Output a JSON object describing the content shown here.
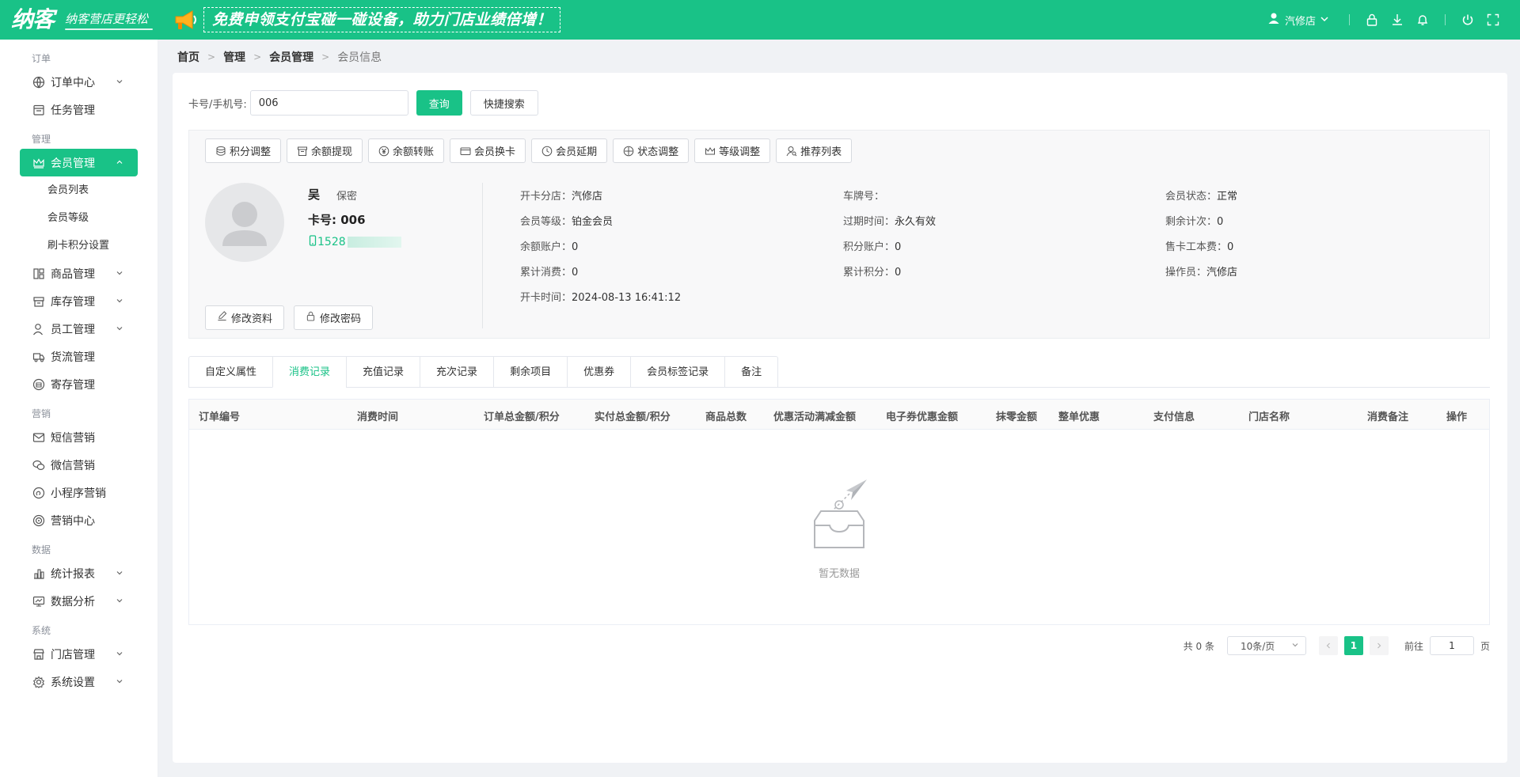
{
  "header": {
    "logo_text": "纳客",
    "slogan": "纳客营店更轻松",
    "promo_text": "免费申领支付宝碰一碰设备，助力门店业绩倍增！",
    "store_name": "汽修店",
    "colors": {
      "brand": "#19c287"
    }
  },
  "sidebar": {
    "groups": [
      {
        "label": "订单",
        "items": [
          {
            "label": "订单中心",
            "icon": "globe-icon"
          },
          {
            "label": "任务管理",
            "icon": "calendar-icon"
          }
        ]
      },
      {
        "label": "管理",
        "items": [
          {
            "label": "会员管理",
            "icon": "crown-icon",
            "active": true,
            "subitems": [
              "会员列表",
              "会员等级",
              "刷卡积分设置"
            ]
          },
          {
            "label": "商品管理",
            "icon": "grid-icon"
          },
          {
            "label": "库存管理",
            "icon": "box-icon"
          },
          {
            "label": "员工管理",
            "icon": "person-icon"
          },
          {
            "label": "货流管理",
            "icon": "truck-icon"
          },
          {
            "label": "寄存管理",
            "icon": "deposit-icon"
          }
        ]
      },
      {
        "label": "营销",
        "items": [
          {
            "label": "短信营销",
            "icon": "mail-icon"
          },
          {
            "label": "微信营销",
            "icon": "wechat-icon"
          },
          {
            "label": "小程序营销",
            "icon": "miniapp-icon"
          },
          {
            "label": "营销中心",
            "icon": "target-icon"
          }
        ]
      },
      {
        "label": "数据",
        "items": [
          {
            "label": "统计报表",
            "icon": "bar-chart-icon"
          },
          {
            "label": "数据分析",
            "icon": "monitor-icon"
          }
        ]
      },
      {
        "label": "系统",
        "items": [
          {
            "label": "门店管理",
            "icon": "store-icon"
          },
          {
            "label": "系统设置",
            "icon": "gear-icon"
          }
        ]
      }
    ]
  },
  "breadcrumb": [
    "首页",
    "管理",
    "会员管理",
    "会员信息"
  ],
  "search": {
    "label": "卡号/手机号:",
    "value": "006",
    "query_button": "查询",
    "quick_button": "快捷搜索"
  },
  "actions": [
    "积分调整",
    "余额提现",
    "余额转账",
    "会员换卡",
    "会员延期",
    "状态调整",
    "等级调整",
    "推荐列表"
  ],
  "member": {
    "name": "吴",
    "gender": "保密",
    "card_label": "卡号: 006",
    "phone_prefix": "1528",
    "edit_profile": "修改资料",
    "edit_password": "修改密码",
    "fields": [
      {
        "label": "开卡分店：",
        "value": "汽修店"
      },
      {
        "label": "车牌号：",
        "value": ""
      },
      {
        "label": "会员状态：",
        "value": "正常"
      },
      {
        "label": "会员等级：",
        "value": "铂金会员"
      },
      {
        "label": "过期时间：",
        "value": "永久有效"
      },
      {
        "label": "剩余计次：",
        "value": "0"
      },
      {
        "label": "余额账户：",
        "value": "0"
      },
      {
        "label": "积分账户：",
        "value": "0"
      },
      {
        "label": "售卡工本费：",
        "value": "0"
      },
      {
        "label": "累计消费：",
        "value": "0"
      },
      {
        "label": "累计积分：",
        "value": "0"
      },
      {
        "label": "操作员：",
        "value": "汽修店"
      },
      {
        "label": "开卡时间：",
        "value": "2024-08-13 16:41:12"
      }
    ]
  },
  "tabs": [
    "自定义属性",
    "消费记录",
    "充值记录",
    "充次记录",
    "剩余项目",
    "优惠券",
    "会员标签记录",
    "备注"
  ],
  "active_tab": "消费记录",
  "table": {
    "columns": [
      "订单编号",
      "消费时间",
      "订单总金额/积分",
      "实付总金额/积分",
      "商品总数",
      "优惠活动满减金额",
      "电子券优惠金额",
      "抹零金额",
      "整单优惠",
      "支付信息",
      "门店名称",
      "消费备注",
      "操作"
    ],
    "empty_text": "暂无数据"
  },
  "pagination": {
    "total": "共 0 条",
    "page_size": "10条/页",
    "current": "1",
    "goto_label": "前往",
    "goto_value": "1",
    "page_unit": "页"
  }
}
